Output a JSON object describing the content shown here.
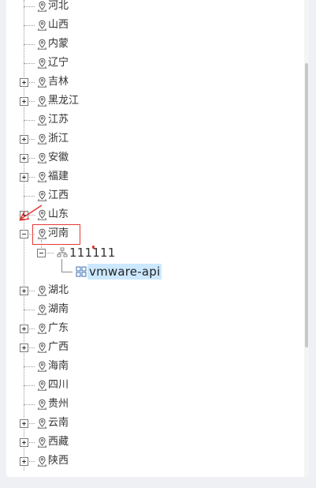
{
  "tree": {
    "provinces": [
      {
        "label": "河北",
        "expandable": false
      },
      {
        "label": "山西",
        "expandable": false
      },
      {
        "label": "内蒙",
        "expandable": false
      },
      {
        "label": "辽宁",
        "expandable": false
      },
      {
        "label": "吉林",
        "expandable": true
      },
      {
        "label": "黑龙江",
        "expandable": true
      },
      {
        "label": "江苏",
        "expandable": false
      },
      {
        "label": "浙江",
        "expandable": true
      },
      {
        "label": "安徽",
        "expandable": true
      },
      {
        "label": "福建",
        "expandable": true
      },
      {
        "label": "江西",
        "expandable": false
      },
      {
        "label": "山东",
        "expandable": true
      },
      {
        "label": "河南",
        "expandable": true,
        "expanded": true
      },
      {
        "label": "湖北",
        "expandable": true
      },
      {
        "label": "湖南",
        "expandable": false
      },
      {
        "label": "广东",
        "expandable": true
      },
      {
        "label": "广西",
        "expandable": true
      },
      {
        "label": "海南",
        "expandable": false
      },
      {
        "label": "四川",
        "expandable": false
      },
      {
        "label": "贵州",
        "expandable": false
      },
      {
        "label": "云南",
        "expandable": true
      },
      {
        "label": "西藏",
        "expandable": true
      },
      {
        "label": "陕西",
        "expandable": true
      }
    ],
    "henan_child": {
      "label": "111111",
      "icon": "network-node-icon",
      "expanded": true
    },
    "henan_grandchild": {
      "label": "vmware-api",
      "icon": "grid-app-icon",
      "selected": true
    },
    "node_icon": "location-pin-icon"
  },
  "annotation": {
    "highlight_color": "#e53935"
  },
  "colors": {
    "selection": "#cce8ff",
    "text": "#333333"
  }
}
